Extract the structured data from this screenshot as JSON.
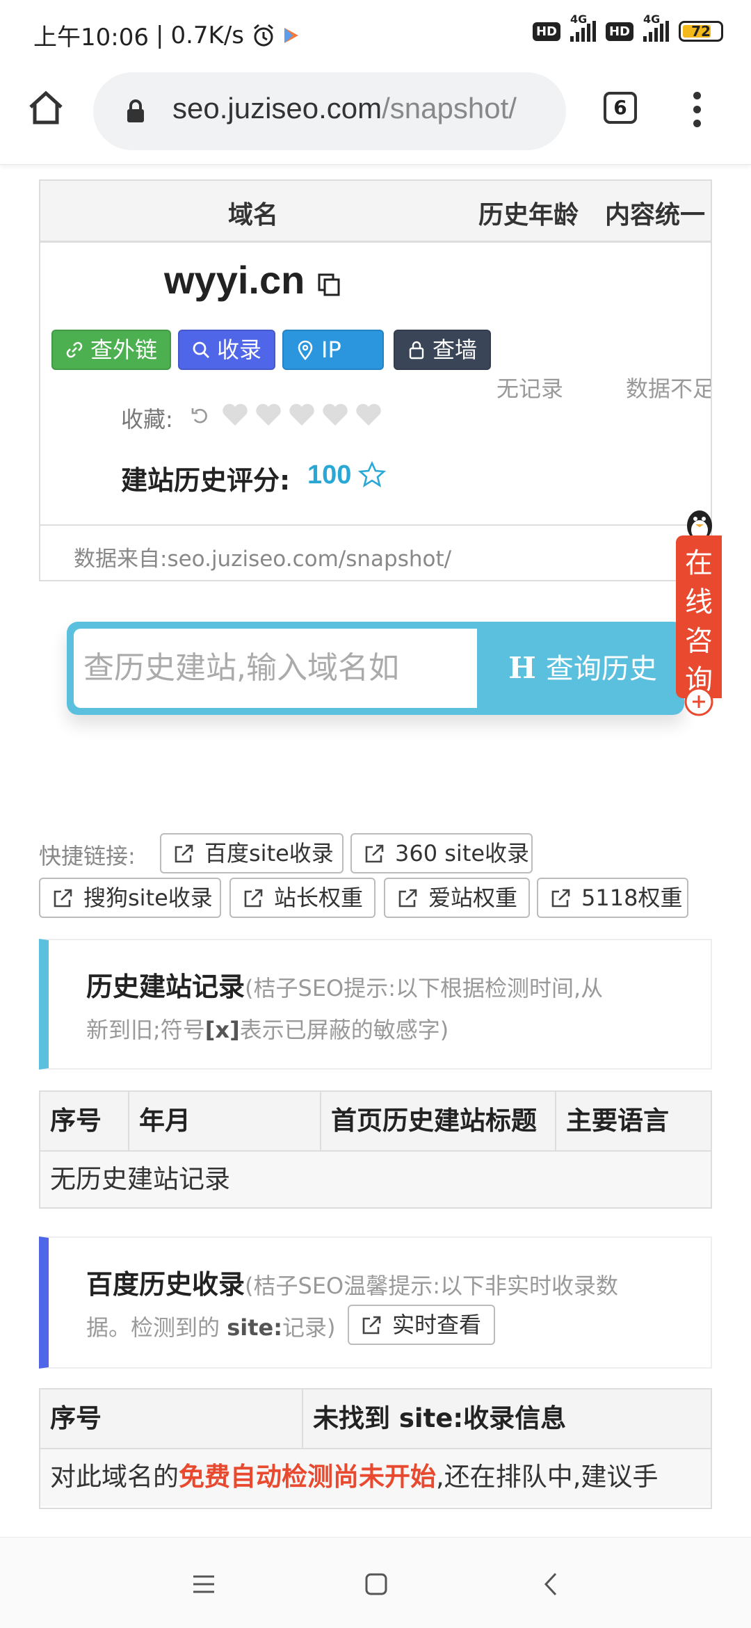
{
  "status_bar": {
    "time": "上午10:06",
    "speed": "0.7K/s",
    "network1": "4G",
    "network2": "4G",
    "hd": "HD",
    "battery": "72",
    "icons": [
      "alarm-icon",
      "play-store-icon",
      "signal-icon",
      "battery-icon"
    ]
  },
  "browser": {
    "url_host": "seo.juziseo.com",
    "url_path": "/snapshot/",
    "tab_count": "6"
  },
  "domain_table": {
    "columns": [
      "域名",
      "历史年龄",
      "内容统一"
    ],
    "domain": "wyyi.cn",
    "buttons": [
      {
        "label": "查外链",
        "icon": "link-icon",
        "color": "#4caf50"
      },
      {
        "label": "收录",
        "icon": "search-icon",
        "color": "#4f66e8"
      },
      {
        "label": "IP",
        "icon": "location-pin-icon",
        "color": "#2b95de"
      },
      {
        "label": "查墙",
        "icon": "lock-icon",
        "color": "#3a4557"
      }
    ],
    "favorite_label": "收藏:",
    "hearts": 5,
    "score_label": "建站历史评分:",
    "score_value": "100",
    "age_value": "无记录",
    "content_value": "数据不足",
    "source_text": "数据来自:seo.juziseo.com/snapshot/"
  },
  "search": {
    "placeholder": "查历史建站,输入域名如",
    "button_label": "查询历史",
    "button_icon_letter": "H"
  },
  "consult": {
    "label": "在线咨询"
  },
  "quick_links": {
    "label": "快捷链接:",
    "items": [
      "百度site收录",
      "360 site收录",
      "搜狗site收录",
      "站长权重",
      "爱站权重",
      "5118权重"
    ]
  },
  "history_section": {
    "title": "历史建站记录",
    "note_line1": "(桔子SEO提示:以下根据检测时间,从",
    "note_line2_a": "新到旧;符号",
    "note_line2_b": "[x]",
    "note_line2_c": "表示已屏蔽的敏感字)",
    "columns": [
      "序号",
      "年月",
      "首页历史建站标题",
      "主要语言"
    ],
    "empty_text": "无历史建站记录"
  },
  "baidu_section": {
    "title": "百度历史收录",
    "note_line1": "(桔子SEO温馨提示:以下非实时收录数",
    "note_line2_a": "据。检测到的 ",
    "note_line2_b": "site:",
    "note_line2_c": "记录)",
    "realtime_button": "实时查看",
    "columns": [
      "序号",
      "未找到 site:收录信息"
    ],
    "row_a": "对此域名的",
    "row_b": "免费自动检测尚未开始",
    "row_c": ",还在排队中,建议手"
  }
}
